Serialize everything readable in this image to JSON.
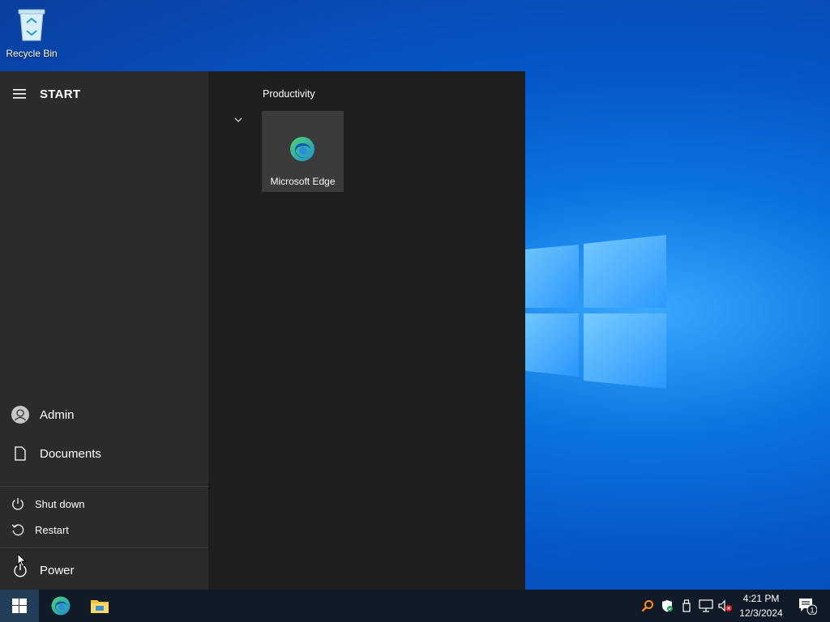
{
  "desktop": {
    "icons": [
      {
        "label": "Recycle Bin",
        "icon": "recycle-bin-icon"
      }
    ]
  },
  "start_menu": {
    "title": "START",
    "rail": {
      "user": "Admin",
      "documents": "Documents",
      "power": "Power"
    },
    "power_popup": {
      "shutdown": "Shut down",
      "restart": "Restart"
    },
    "groups": [
      {
        "label": "Productivity",
        "tiles": [
          {
            "label": "Microsoft Edge",
            "icon": "edge-icon"
          }
        ]
      }
    ]
  },
  "taskbar": {
    "pinned": [
      "edge-icon",
      "file-explorer-icon"
    ],
    "tray_icons": [
      "search-highlight-icon",
      "security-icon",
      "usb-icon",
      "network-icon",
      "volume-muted-icon"
    ],
    "time": "4:21 PM",
    "date": "12/3/2024",
    "notifications_count": "1"
  }
}
